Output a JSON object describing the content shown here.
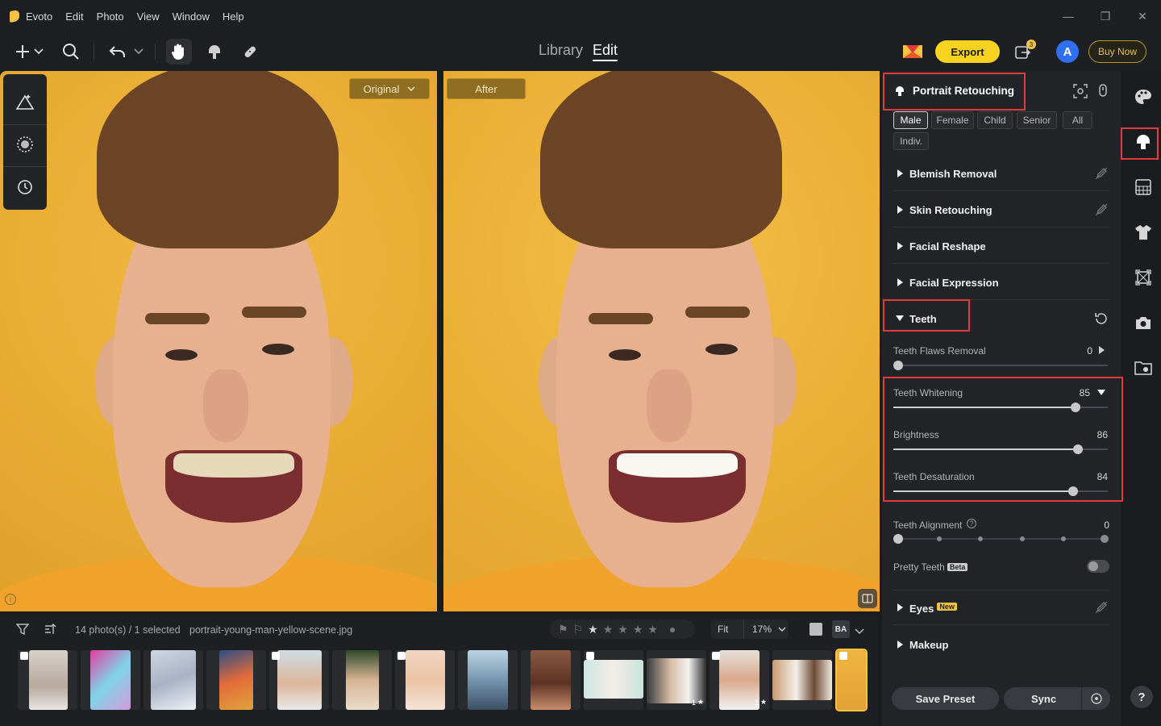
{
  "app": {
    "name": "Evoto"
  },
  "menu": [
    "Edit",
    "Photo",
    "View",
    "Window",
    "Help"
  ],
  "modes": {
    "library": "Library",
    "edit": "Edit"
  },
  "toolbar": {
    "export_label": "Export",
    "buy_label": "Buy Now",
    "avatar_letter": "A",
    "notification_count": "3"
  },
  "canvas": {
    "original_label": "Original",
    "after_label": "After"
  },
  "filmstrip": {
    "count_text": "14 photo(s) / 1 selected",
    "filename": "portrait-young-man-yellow-scene.jpg",
    "fit_label": "Fit",
    "zoom_label": "17%",
    "star_badges": [
      "1",
      "1"
    ]
  },
  "panel": {
    "title": "Portrait Retouching",
    "chips": [
      "Male",
      "Female",
      "Child",
      "Senior",
      "All",
      "Indiv."
    ],
    "sections": {
      "blemish": "Blemish Removal",
      "skin": "Skin Retouching",
      "reshape": "Facial Reshape",
      "expression": "Facial Expression",
      "teeth": "Teeth",
      "eyes": "Eyes",
      "makeup": "Makeup"
    },
    "eyes_badge": "New",
    "sliders": {
      "flaws": {
        "label": "Teeth Flaws Removal",
        "value": 0
      },
      "whitening": {
        "label": "Teeth Whitening",
        "value": 85
      },
      "brightness": {
        "label": "Brightness",
        "value": 86
      },
      "desaturation": {
        "label": "Teeth Desaturation",
        "value": 84
      },
      "alignment": {
        "label": "Teeth Alignment",
        "value": 0
      }
    },
    "pretty_teeth": {
      "label": "Pretty Teeth",
      "badge": "Beta"
    },
    "save_preset": "Save Preset",
    "sync": "Sync"
  },
  "colors": {
    "accent": "#f7d21e",
    "highlight": "#e23b3b",
    "avatar": "#2f6ff2"
  }
}
